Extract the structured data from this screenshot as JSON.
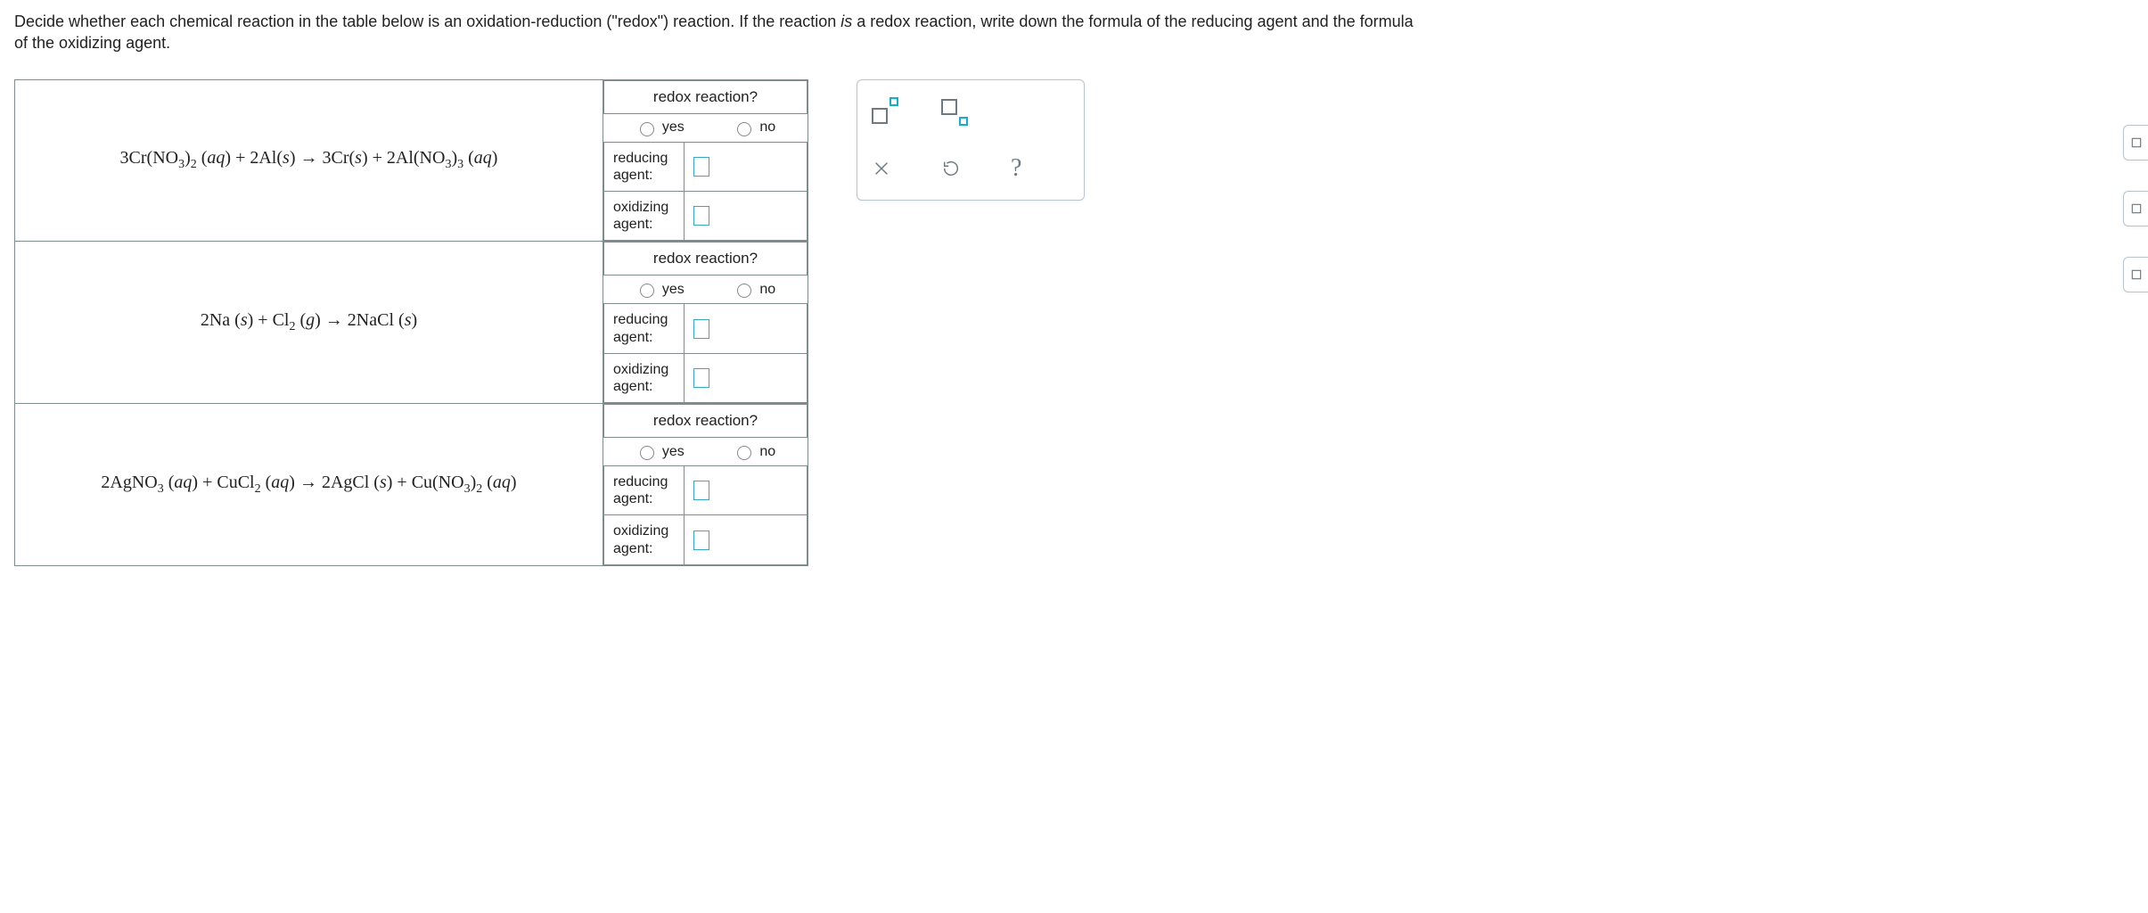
{
  "prompt": {
    "pre": "Decide whether each chemical reaction in the table below is an oxidation-reduction (\"redox\") reaction. If the reaction ",
    "em": "is",
    "post": " a redox reaction, write down the formula of the reducing agent and the formula of the oxidizing agent."
  },
  "labels": {
    "redox_q": "redox reaction?",
    "yes": "yes",
    "no": "no",
    "reducing": "reducing agent:",
    "oxidizing": "oxidizing agent:"
  },
  "reactions": [
    {
      "html": "3Cr(NO<span class='sb'>3</span>)<span class='sb'>2</span> (<i>aq</i>) + 2Al(<i>s</i>)  →  3Cr(<i>s</i>) + 2Al(NO<span class='sb'>3</span>)<span class='sb'>3</span> (<i>aq</i>)"
    },
    {
      "html": "2Na (<i>s</i>) + Cl<span class='sb'>2</span> (<i>g</i>)  →  2NaCl (<i>s</i>)"
    },
    {
      "html": "2AgNO<span class='sb'>3</span> (<i>aq</i>) + CuCl<span class='sb'>2</span> (<i>aq</i>)  →  2AgCl (<i>s</i>) + Cu(NO<span class='sb'>3</span>)<span class='sb'>2</span> (<i>aq</i>)"
    }
  ],
  "toolbox": {
    "superscript": "superscript-tool",
    "subscript": "subscript-tool",
    "clear": "clear",
    "reset": "reset",
    "help": "?"
  }
}
